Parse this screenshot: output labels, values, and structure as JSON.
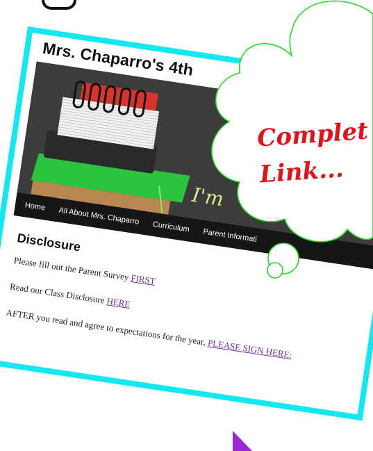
{
  "site": {
    "title": "Mrs. Chaparro's 4th"
  },
  "banner": {
    "chalk_text": "I'm"
  },
  "nav": {
    "items": [
      {
        "label": "Home"
      },
      {
        "label": "All About Mrs. Chaparro"
      },
      {
        "label": "Curriculum"
      },
      {
        "label": "Parent Informati"
      }
    ]
  },
  "content": {
    "heading": "Disclosure",
    "paragraphs": [
      {
        "text": "Please fill out the Parent Survey ",
        "link": "FIRST"
      },
      {
        "text": "Read our Class Disclosure ",
        "link": "HERE"
      },
      {
        "text": "AFTER you read and agree to expectations for the year, ",
        "link": "PLEASE SIGN HERE:"
      }
    ]
  },
  "callout": {
    "line1": "Complet",
    "line2": "Link..."
  },
  "colors": {
    "frame": "#12e8f2",
    "bubble_outline": "#22dd22",
    "callout_text": "#e3121b",
    "link": "#6a2fa0",
    "cursor": "#9b28d6"
  }
}
